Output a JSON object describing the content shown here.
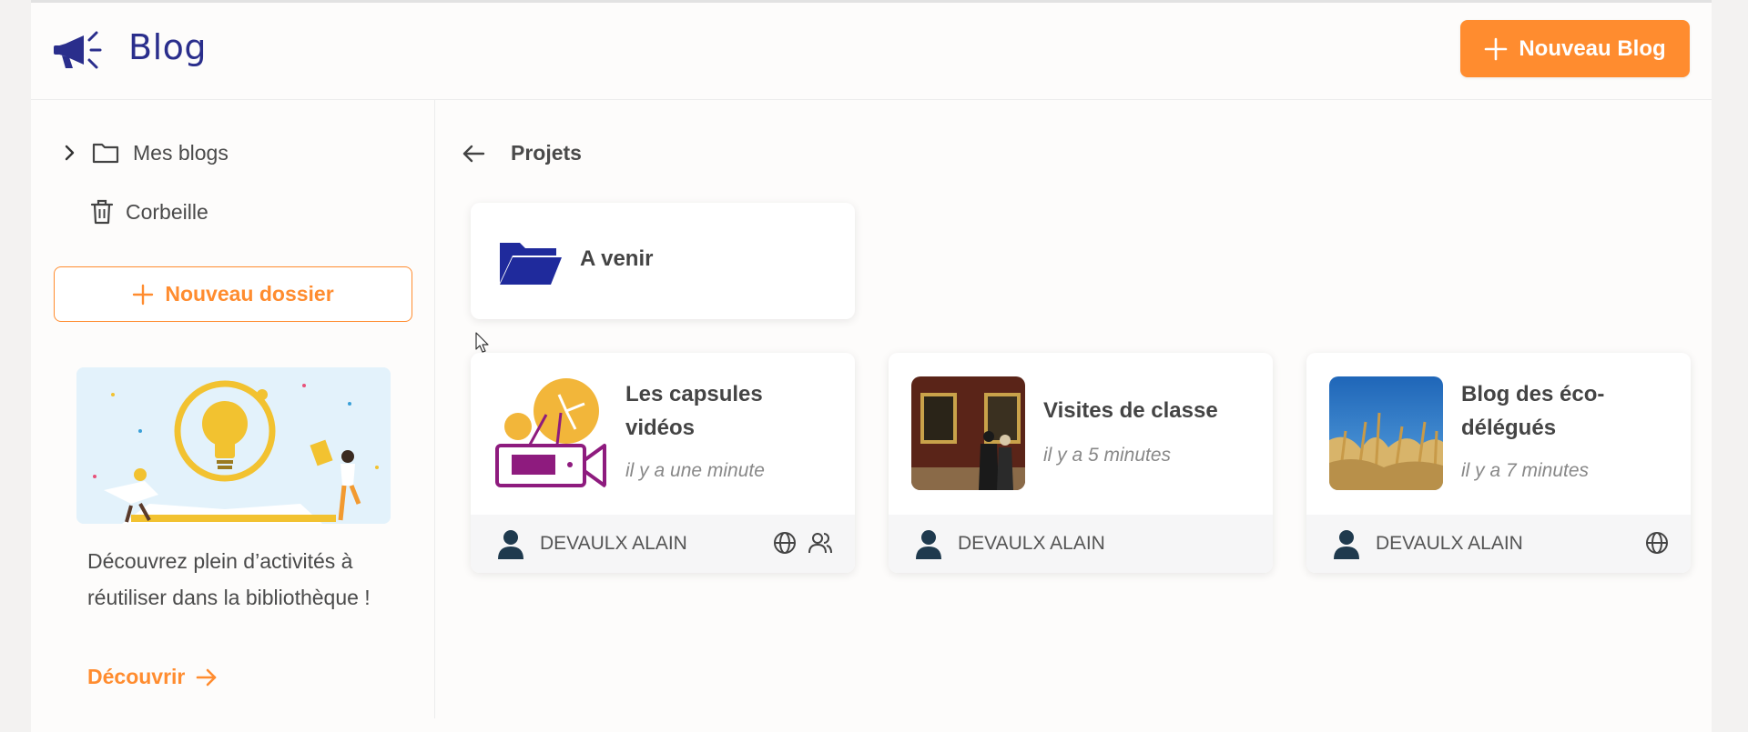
{
  "header": {
    "app_title": "Blog",
    "new_blog_label": "Nouveau Blog"
  },
  "sidebar": {
    "my_blogs": "Mes blogs",
    "trash": "Corbeille",
    "new_folder_label": "Nouveau dossier",
    "promo_text": "Découvrez plein d’activités à réutiliser dans la bibliothèque !",
    "promo_link": "Découvrir"
  },
  "main": {
    "breadcrumb": "Projets",
    "folders": [
      {
        "name": "A venir"
      }
    ],
    "blogs": [
      {
        "title": "Les capsules vidéos",
        "date": "il y a une minute",
        "author": "DEVAULX ALAIN",
        "icons": [
          "globe-icon",
          "users-icon"
        ]
      },
      {
        "title": "Visites de classe",
        "date": "il y a 5 minutes",
        "author": "DEVAULX ALAIN",
        "icons": []
      },
      {
        "title": "Blog des éco-délégués",
        "date": "il y a 7 minutes",
        "author": "DEVAULX ALAIN",
        "icons": [
          "globe-icon"
        ]
      }
    ]
  },
  "colors": {
    "accent": "#ff8c2f",
    "brand": "#2a2e8c",
    "folder": "#1f2a9c"
  }
}
